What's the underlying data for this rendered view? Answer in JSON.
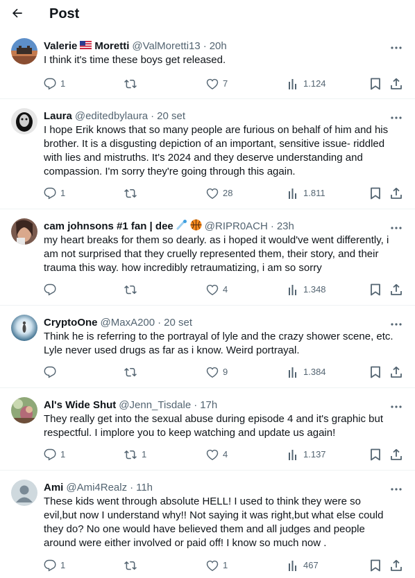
{
  "header": {
    "title": "Post",
    "back_icon": "arrow-left-icon"
  },
  "colors": {
    "text": "#0f1419",
    "secondary": "#536471",
    "border": "#eff3f4"
  },
  "replies": [
    {
      "name_first": "Valerie",
      "name_emoji": "us-flag",
      "name_last": "Moretti",
      "handle": "@ValMoretti13",
      "time": "20h",
      "text": "I think it's time these boys get released.",
      "reply_count": "1",
      "repost_count": "",
      "like_count": "7",
      "views": "1.124"
    },
    {
      "name": "Laura",
      "handle": "@editedbylaura",
      "time": "20 set",
      "text": "I hope Erik knows that so many people are furious on behalf of him and his\nbrother. It is a disgusting depiction of an important, sensitive issue- riddled\nwith lies and mistruths. It's 2024 and they deserve understanding and\ncompassion. I'm sorry they're going through this again.",
      "reply_count": "1",
      "repost_count": "",
      "like_count": "28",
      "views": "1.811"
    },
    {
      "name": "cam johnsons #1 fan | dee",
      "name_emojis": [
        "comet",
        "basketball"
      ],
      "handle": "@RIPR0ACH",
      "time": "23h",
      "text": "my heart breaks for them so dearly. as i hoped it would've went differently, i\nam not surprised that they cruelly represented them, their story, and their\ntrauma this way. how incredibly retraumatizing, i am so sorry",
      "reply_count": "",
      "repost_count": "",
      "like_count": "4",
      "views": "1.348"
    },
    {
      "name": "CryptoOne",
      "handle": "@MaxA200",
      "time": "20 set",
      "text": "Think he is referring to the portrayal of lyle and the crazy shower scene, etc.\nLyle never used drugs as far as i know. Weird portrayal.",
      "reply_count": "",
      "repost_count": "",
      "like_count": "9",
      "views": "1.384"
    },
    {
      "name": "Al's Wide Shut",
      "handle": "@Jenn_Tisdale",
      "time": "17h",
      "text": "They really get into the sexual abuse during episode 4 and it's graphic but\nrespectful. I implore you to keep watching and update us again!",
      "reply_count": "1",
      "repost_count": "1",
      "like_count": "4",
      "views": "1.137"
    },
    {
      "name": "Ami",
      "handle": "@Ami4Realz",
      "time": "11h",
      "text": "These kids went through absolute HELL! I used to think they were so\nevil,but now I understand why!! Not saying it was right,but what else could\nthey do? No one would have believed them and all judges and people\naround were either involved or paid off! I know so much now .",
      "reply_count": "1",
      "repost_count": "",
      "like_count": "1",
      "views": "467"
    }
  ]
}
